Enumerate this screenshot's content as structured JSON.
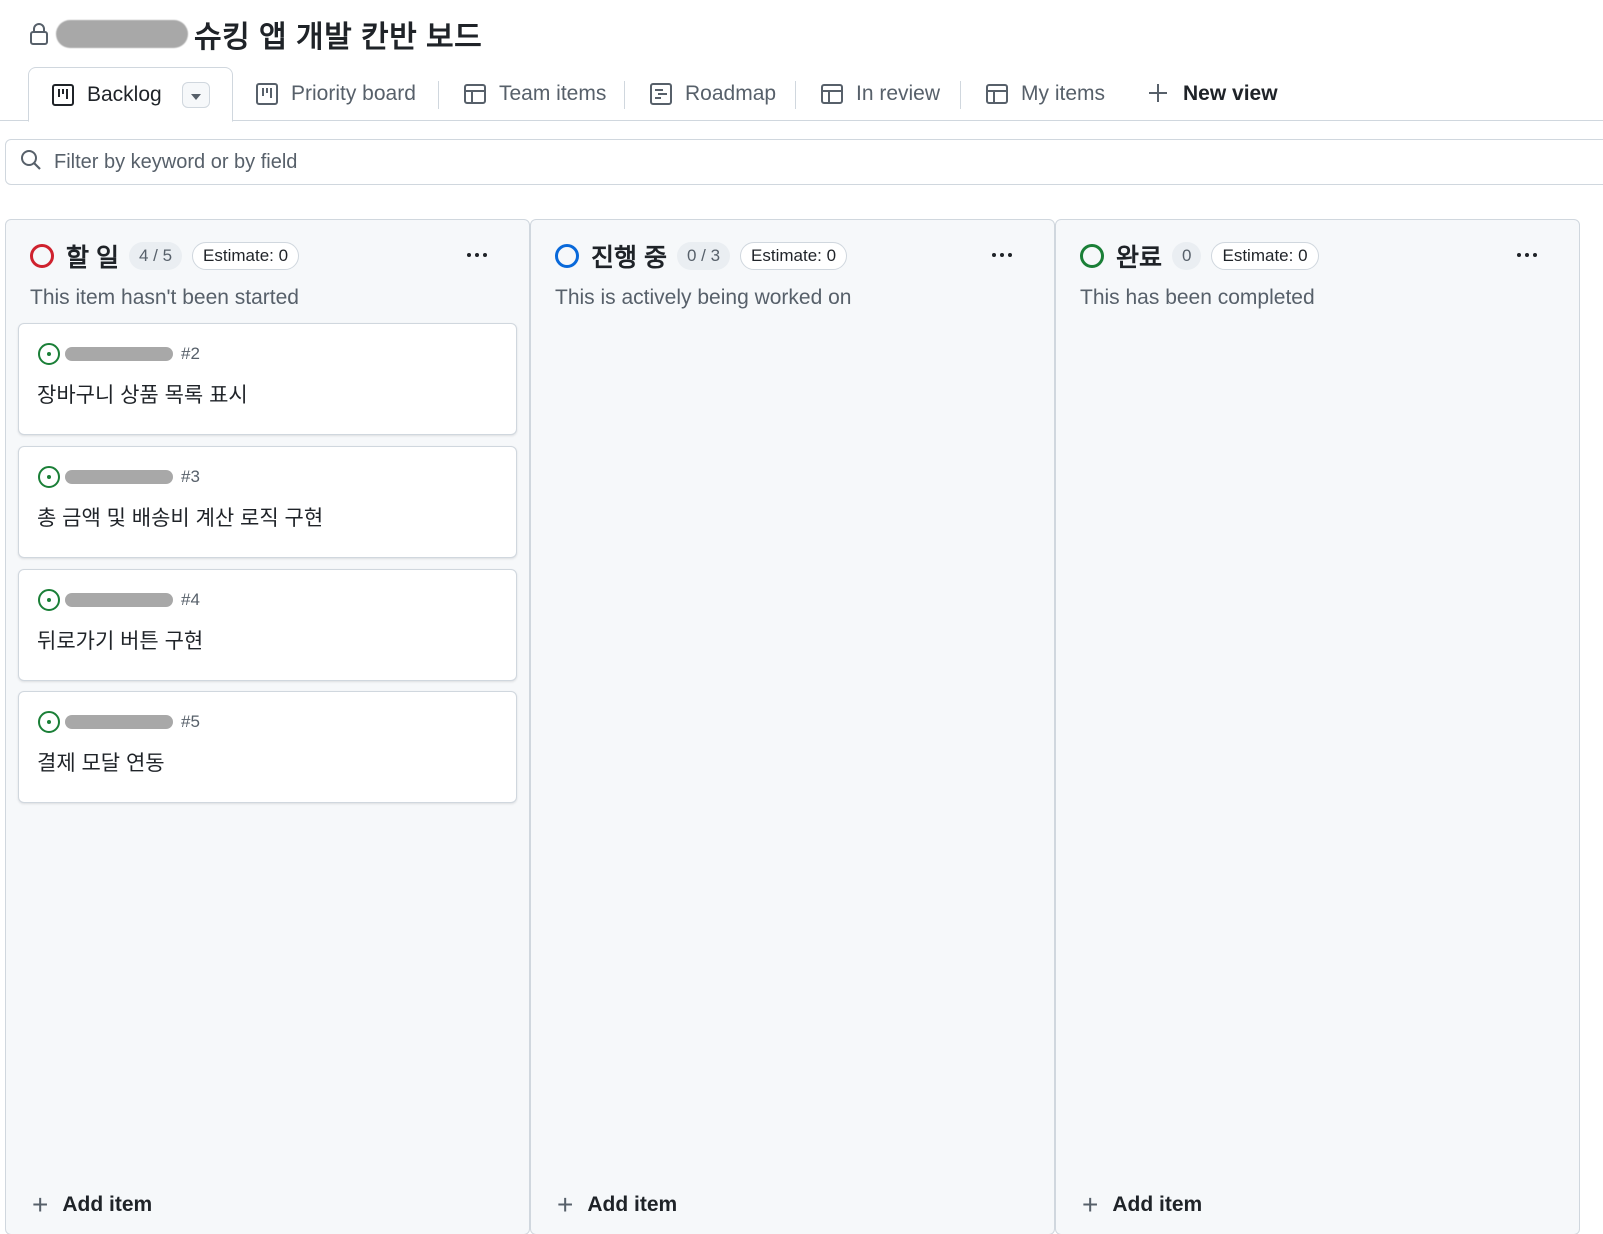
{
  "project": {
    "title": "슈킹 앱 개발 칸반 보드",
    "owner_redacted": ""
  },
  "tabs": [
    {
      "label": "Backlog",
      "icon": "board-icon",
      "active": true
    },
    {
      "label": "Priority board",
      "icon": "board-icon"
    },
    {
      "label": "Team items",
      "icon": "table-icon"
    },
    {
      "label": "Roadmap",
      "icon": "roadmap-icon"
    },
    {
      "label": "In review",
      "icon": "table-icon"
    },
    {
      "label": "My items",
      "icon": "table-icon"
    }
  ],
  "new_view_label": "New view",
  "filter": {
    "placeholder": "Filter by keyword or by field"
  },
  "columns": [
    {
      "title": "할 일",
      "count": "4 / 5",
      "estimate": "Estimate: 0",
      "description": "This item hasn't been started",
      "status_color": "#cf222e",
      "cards": [
        {
          "number": "#2",
          "title": "장바구니 상품 목록 표시"
        },
        {
          "number": "#3",
          "title": "총 금액 및 배송비 계산 로직 구현"
        },
        {
          "number": "#4",
          "title": "뒤로가기 버튼 구현"
        },
        {
          "number": "#5",
          "title": "결제 모달 연동"
        }
      ],
      "add_item_label": "Add item"
    },
    {
      "title": "진행 중",
      "count": "0 / 3",
      "estimate": "Estimate: 0",
      "description": "This is actively being worked on",
      "status_color": "#0969da",
      "cards": [],
      "add_item_label": "Add item"
    },
    {
      "title": "완료",
      "count": "0",
      "estimate": "Estimate: 0",
      "description": "This has been completed",
      "status_color": "#1a7f37",
      "cards": [],
      "add_item_label": "Add item"
    }
  ],
  "colors": {
    "issue_open": "#1a7f37",
    "border": "#d0d7de",
    "muted_text": "#57606a"
  }
}
